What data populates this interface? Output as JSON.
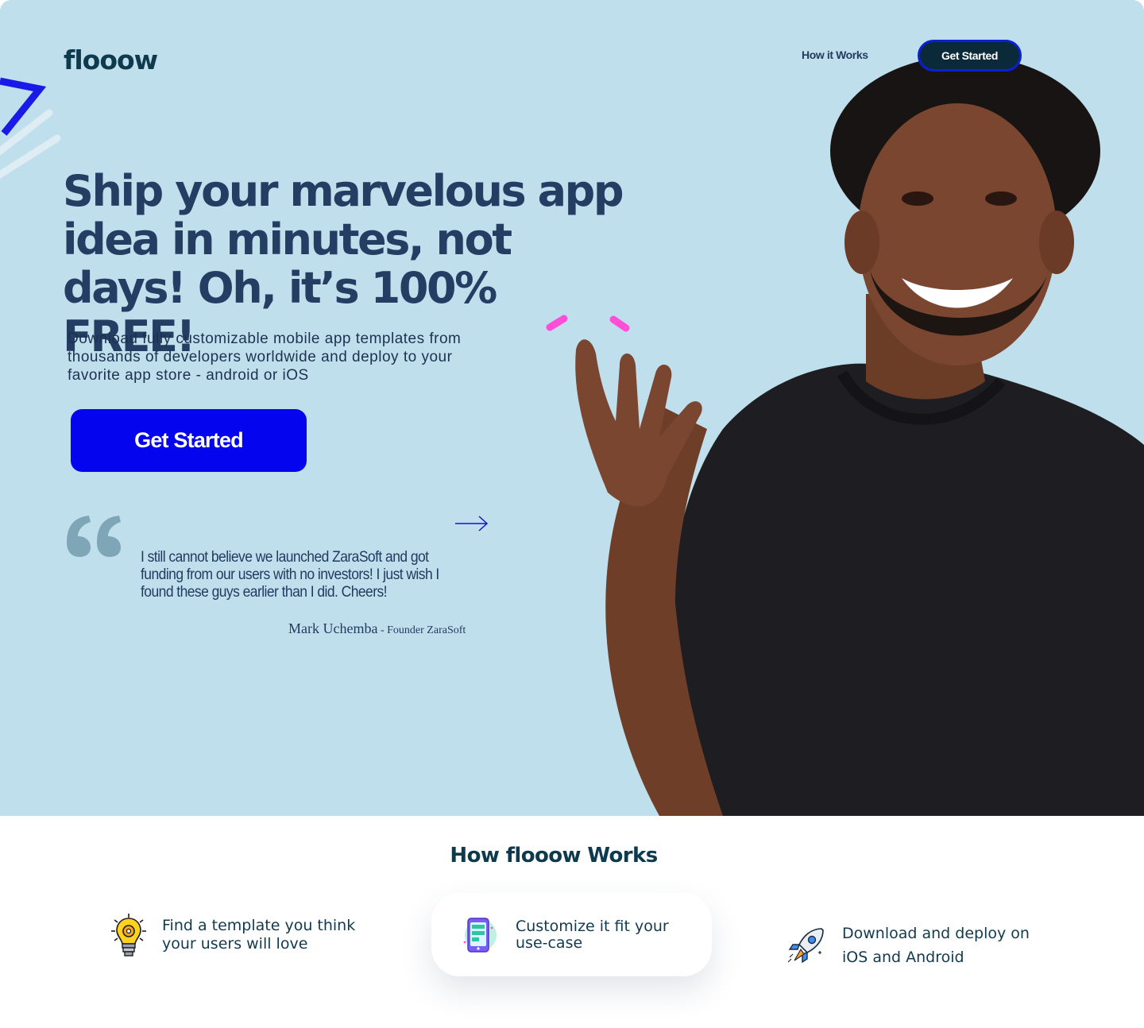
{
  "brand": {
    "logo": "flooow"
  },
  "nav": {
    "how_it_works": "How it Works",
    "get_started": "Get Started"
  },
  "hero": {
    "headline": "Ship your marvelous app idea in minutes, not days! Oh, it’s 100% FREE!",
    "subtext": "Download fully customizable mobile app templates from thousands of developers worldwide and deploy to your favorite app store - android or iOS",
    "cta": "Get Started"
  },
  "testimonial": {
    "quote": "I still cannot believe we launched ZaraSoft and got funding from our users with no investors! I just wish I found these guys earlier than I did. Cheers!",
    "author": "Mark Uchemba",
    "separator": " - ",
    "role": "Founder ZaraSoft",
    "next_icon": "arrow-right-icon"
  },
  "how": {
    "title": "How flooow Works",
    "steps": [
      {
        "icon": "lightbulb-gear-icon",
        "label": "Find a template you think your users will love"
      },
      {
        "icon": "phone-app-icon",
        "label": "Customize it fit your use-case"
      },
      {
        "icon": "rocket-icon",
        "label": "Download and deploy on iOS and Android"
      }
    ]
  },
  "colors": {
    "hero_bg": "#c0dfec",
    "primary_blue": "#0404ee",
    "heading": "#243d63",
    "accent_pink": "#ff4fd8"
  }
}
